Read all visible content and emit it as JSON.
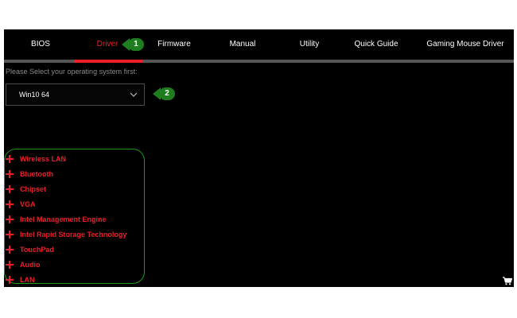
{
  "tabs": [
    {
      "label": "BIOS",
      "active": false
    },
    {
      "label": "Driver",
      "active": true
    },
    {
      "label": "Firmware",
      "active": false
    },
    {
      "label": "Manual",
      "active": false
    },
    {
      "label": "Utility",
      "active": false
    },
    {
      "label": "Quick Guide",
      "active": false
    },
    {
      "label": "Gaming Mouse Driver",
      "active": false
    }
  ],
  "callouts": [
    "1",
    "2"
  ],
  "os": {
    "prompt": "Please Select your operating system first:",
    "selected": "Win10 64"
  },
  "categories": [
    "Wireless LAN",
    "Bluetooth",
    "Chipset",
    "VGA",
    "Intel Management Engine",
    "Intel Rapid Storage Technology",
    "TouchPad",
    "Audio",
    "LAN"
  ],
  "icons": {
    "expand": "plus-icon",
    "dropdown": "chevron-down-icon",
    "cart": "cart-icon"
  },
  "colors": {
    "background": "#000000",
    "accent": "#e8202a",
    "annotation": "#1e7d1e",
    "tab_text": "#ffffff",
    "muted_text": "#8a8a8a"
  }
}
